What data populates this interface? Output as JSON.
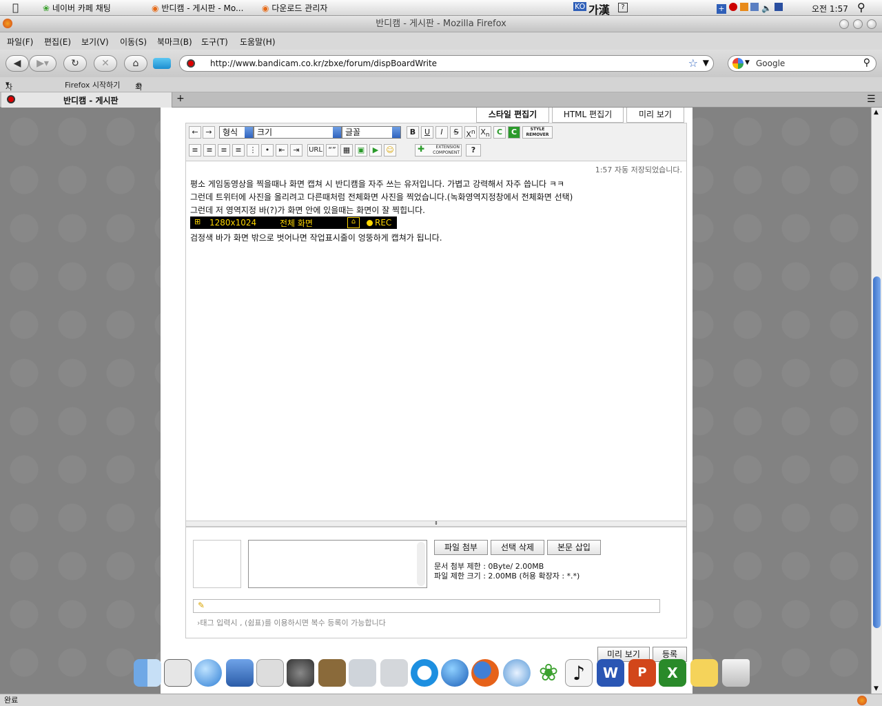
{
  "menubar": {
    "tasks": [
      "네이버 카페 채팅",
      "반디캠 - 게시판 - Mo...",
      "다운로드 관리자"
    ],
    "ime": "KO",
    "ime_chars": "가漢",
    "clock": "오전 1:57"
  },
  "window": {
    "title": "반디캠 - 게시판 - Mozilla Firefox"
  },
  "menu": [
    "파일(F)",
    "편집(E)",
    "보기(V)",
    "이동(S)",
    "북마크(B)",
    "도구(T)",
    "도움말(H)"
  ],
  "nav": {
    "url": "http://www.bandicam.co.kr/zbxe/forum/dispBoardWrite",
    "search_placeholder": "Google"
  },
  "bookmarks": [
    "자주 방문 순",
    "Firefox 시작하기",
    "최신 뉴스 보기"
  ],
  "tab": {
    "title": "반디캠 - 게시판",
    "new_tab": "+"
  },
  "editor": {
    "tabs": [
      "스타일 편집기",
      "HTML 편집기",
      "미리 보기"
    ],
    "selects": {
      "format": "형식",
      "size": "크기",
      "font": "글꼴"
    },
    "buttons": {
      "bold": "B",
      "underline": "U",
      "italic": "I",
      "strike": "S",
      "sup": "X",
      "sub": "X",
      "url": "URL",
      "quote": "“”",
      "style_remover": "STYLE REMOVER",
      "extension": "EXTENSION COMPONENT",
      "help": "?"
    },
    "autosave": "1:57 자동 저장되었습니다.",
    "lines": [
      "평소 게임동영상을 찍을때나 화면 캡쳐 시 반디캠을 자주 쓰는 유저입니다. 가볍고 강력해서 자주 씁니다 ㅋㅋ",
      "그런데 트위터에 사진을 올리려고 다른때처럼 전체화면 사진을 찍었습니다.(녹화영역지정창에서 전체화면 선택)",
      "그런데 저 영역지정 바(?)가 화면 안에 있을때는 화면이 잘 찍힙니다.",
      "검정색 바가 화면 밖으로 벗어나면 작업표시줄이 엉뚱하게 캡쳐가 됩니다."
    ],
    "blackbar": {
      "resolution": "1280x1024",
      "mode": "전체 화면",
      "rec": "REC"
    }
  },
  "attach": {
    "buttons": [
      "파일 첨부",
      "선택 삭제",
      "본문 삽입"
    ],
    "limit_doc": "문서 첨부 제한 : 0Byte/ 2.00MB",
    "limit_file": "파일 제한 크기 : 2.00MB (허용 확장자 : *.*)",
    "tag_hint": "태그 입력시 , (쉼표)를 이용하시면 복수 등록이 가능합니다"
  },
  "bottom_buttons": [
    "미리 보기",
    "등록"
  ],
  "status": "완료",
  "colors": {
    "accent": "#3d73c9",
    "rec": "#ffd700",
    "blackbar": "#000000"
  }
}
